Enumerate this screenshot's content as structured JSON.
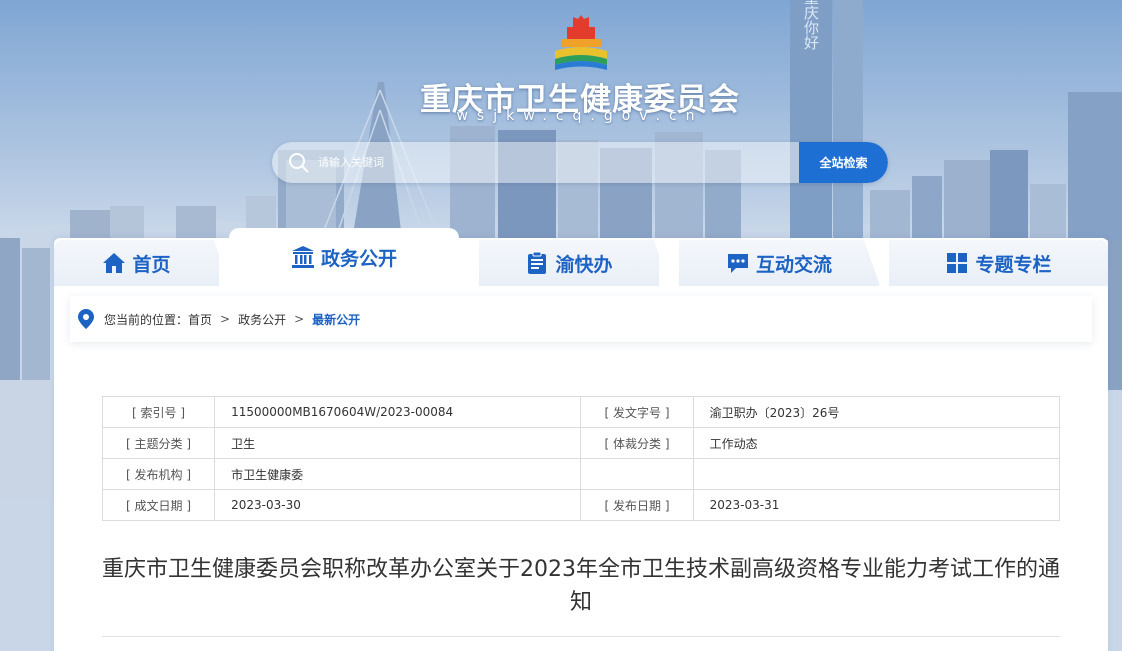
{
  "header": {
    "site_title": "重庆市卫生健康委员会",
    "site_domain": "wsjkw.cq.gov.cn",
    "logo_icon": "government-building-logo-icon"
  },
  "search": {
    "placeholder": "请输入关键词",
    "button_label": "全站检索"
  },
  "billboard": {
    "left_text": "重庆你好",
    "right_text": "你好"
  },
  "nav": {
    "tabs": [
      {
        "label": "首页",
        "icon": "home-icon",
        "active": false
      },
      {
        "label": "政务公开",
        "icon": "government-building-icon",
        "active": true
      },
      {
        "label": "渝快办",
        "icon": "clipboard-icon",
        "active": false
      },
      {
        "label": "互动交流",
        "icon": "chat-bubble-icon",
        "active": false
      },
      {
        "label": "专题专栏",
        "icon": "grid-icon",
        "active": false
      }
    ]
  },
  "breadcrumb": {
    "prefix": "您当前的位置：",
    "items": [
      "首页",
      "政务公开",
      "最新公开"
    ],
    "separator": ">"
  },
  "meta": {
    "rows": [
      [
        {
          "label": "[ 索引号 ]",
          "value": "11500000MB1670604W/2023-00084"
        },
        {
          "label": "[ 发文字号 ]",
          "value": "渝卫职办〔2023〕26号"
        }
      ],
      [
        {
          "label": "[ 主题分类 ]",
          "value": "卫生"
        },
        {
          "label": "[ 体裁分类 ]",
          "value": "工作动态"
        }
      ],
      [
        {
          "label": "[ 发布机构 ]",
          "value": "市卫生健康委"
        },
        {
          "label": "",
          "value": ""
        }
      ],
      [
        {
          "label": "[ 成文日期 ]",
          "value": "2023-03-30"
        },
        {
          "label": "[ 发布日期 ]",
          "value": "2023-03-31"
        }
      ]
    ]
  },
  "article": {
    "title": "重庆市卫生健康委员会职称改革办公室关于2023年全市卫生技术副高级资格专业能力考试工作的通知"
  },
  "colors": {
    "brand_blue": "#1d63c4",
    "search_button": "#1d6fd3"
  }
}
